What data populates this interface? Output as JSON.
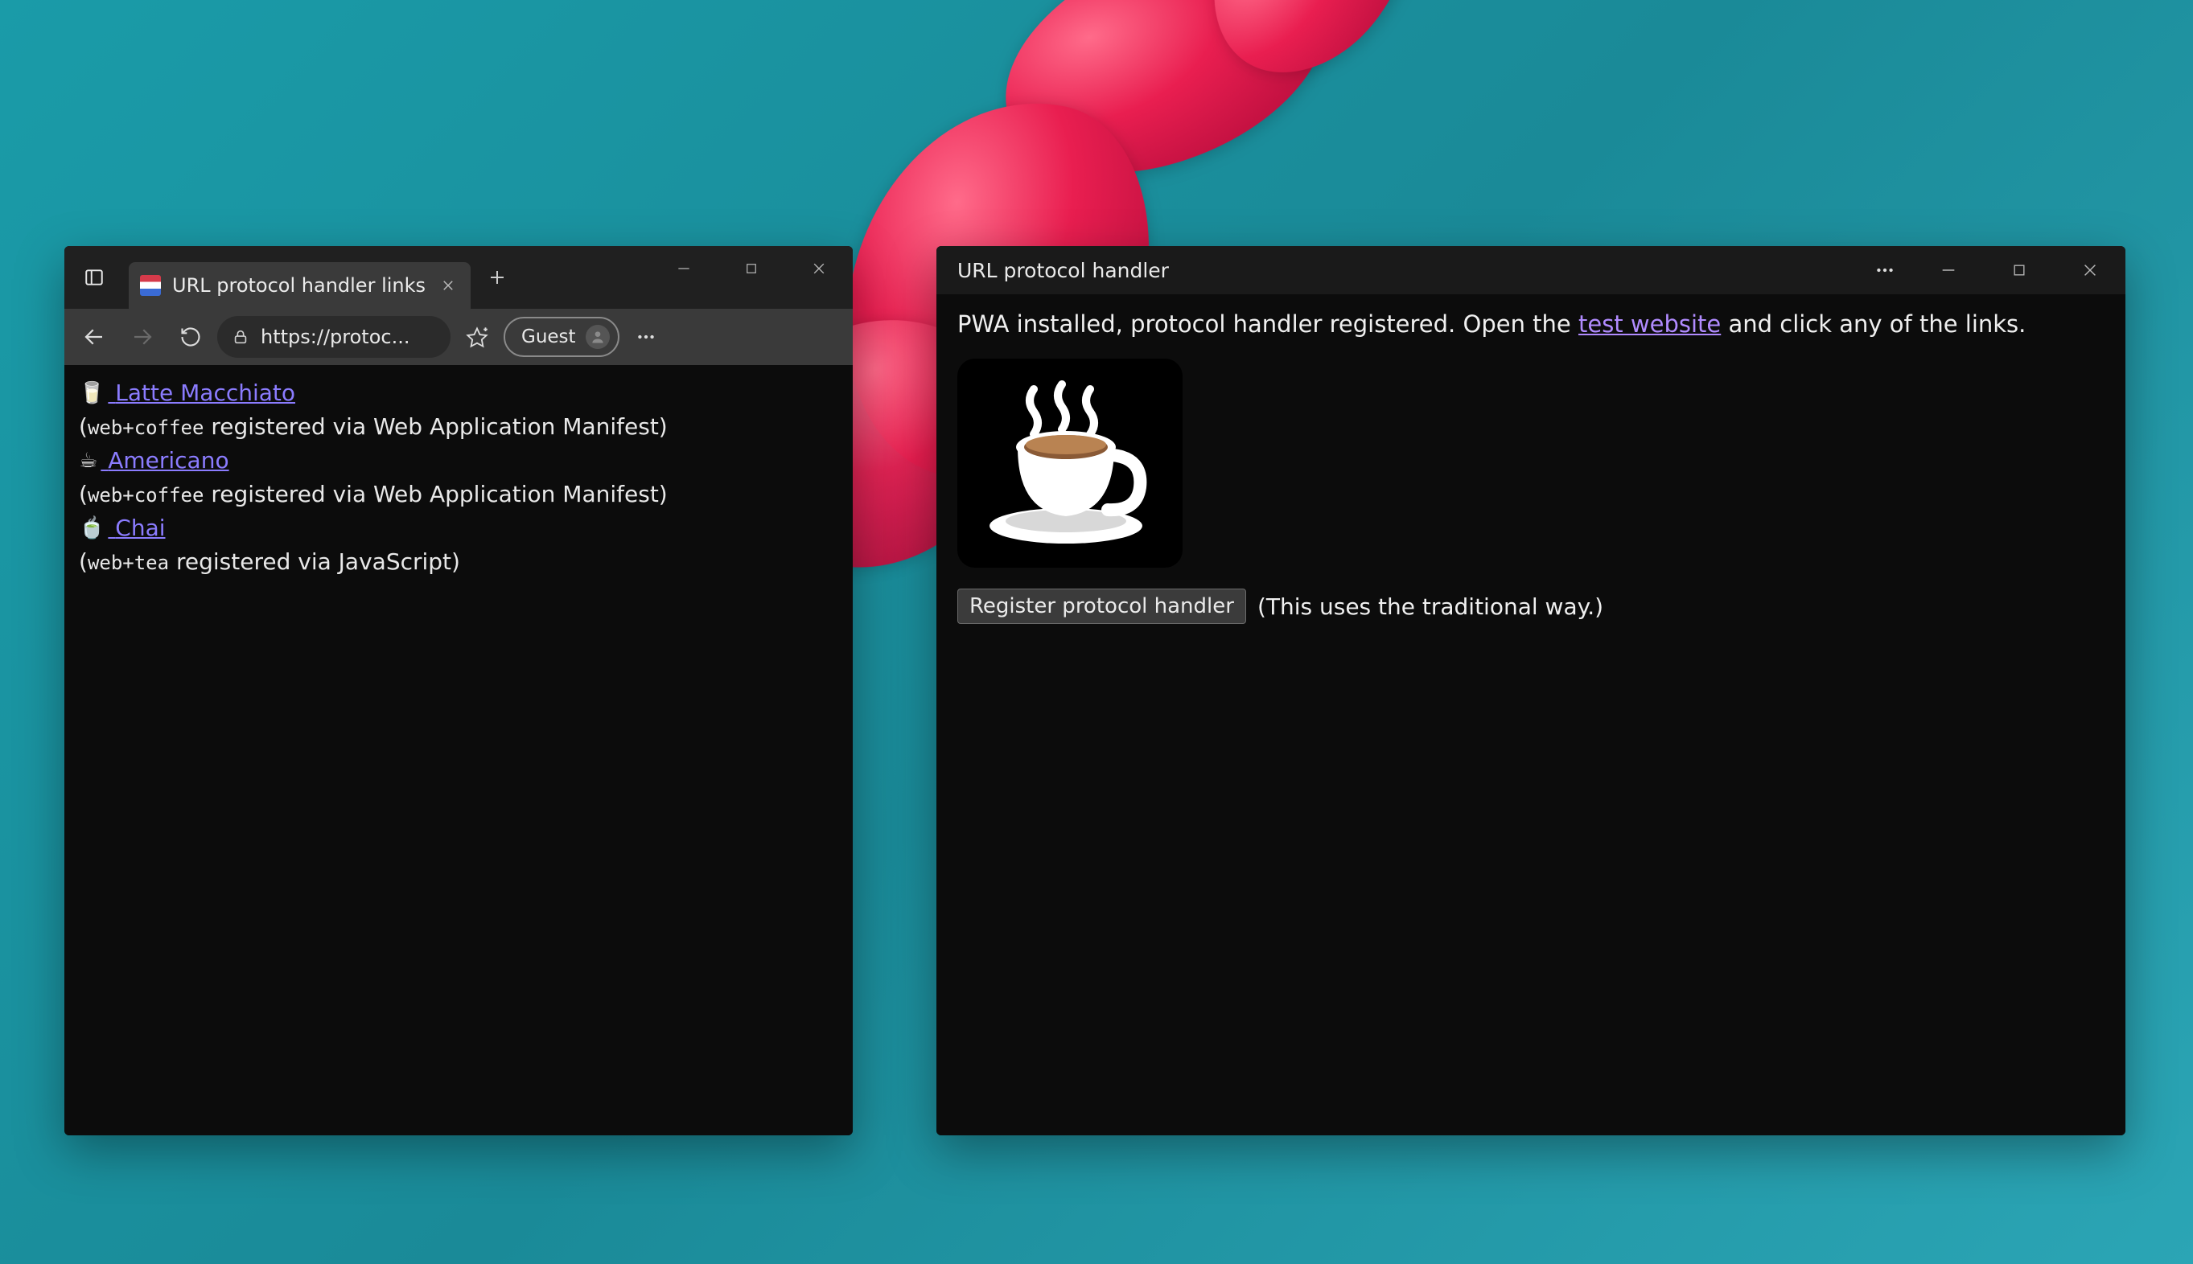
{
  "browser": {
    "tab": {
      "title": "URL protocol handler links"
    },
    "address": "https://protoc...",
    "profile_label": "Guest",
    "page": {
      "links": [
        {
          "icon": "🥛",
          "label": "Latte Macchiato",
          "sub_prefix": "(",
          "proto": "web+coffee",
          "sub_rest": " registered via Web Application Manifest)"
        },
        {
          "icon": "☕",
          "label": "Americano",
          "sub_prefix": "(",
          "proto": "web+coffee",
          "sub_rest": " registered via Web Application Manifest)"
        },
        {
          "icon": "🍵",
          "label": "Chai",
          "sub_prefix": "(",
          "proto": "web+tea",
          "sub_rest": " registered via JavaScript)"
        }
      ]
    }
  },
  "pwa": {
    "title": "URL protocol handler",
    "intro_before": "PWA installed, protocol handler registered. Open the ",
    "intro_link": "test website",
    "intro_after": " and click any of the links.",
    "button_label": "Register protocol handler",
    "button_hint": "(This uses the traditional way.)"
  }
}
